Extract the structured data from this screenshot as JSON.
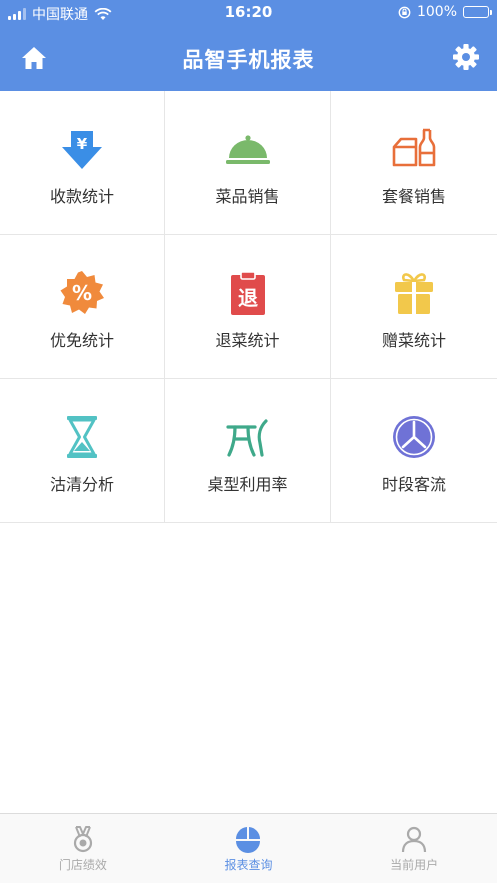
{
  "status_bar": {
    "carrier": "中国联通",
    "time": "16:20",
    "battery": "100%"
  },
  "nav": {
    "title": "品智手机报表",
    "home_icon": "home-icon",
    "settings_icon": "gear-icon"
  },
  "grid": {
    "items": [
      {
        "label": "收款统计",
        "icon": "yen-down-arrow-icon",
        "color": "#3a8ee6"
      },
      {
        "label": "菜品销售",
        "icon": "food-cloche-icon",
        "color": "#7ab96b"
      },
      {
        "label": "套餐销售",
        "icon": "meal-set-icon",
        "color": "#e86f3a"
      },
      {
        "label": "优免统计",
        "icon": "discount-badge-icon",
        "color": "#f08a3c"
      },
      {
        "label": "退菜统计",
        "icon": "return-clipboard-icon",
        "color": "#e04b4b"
      },
      {
        "label": "赠菜统计",
        "icon": "gift-icon",
        "color": "#f2c84b"
      },
      {
        "label": "沽清分析",
        "icon": "hourglass-icon",
        "color": "#52c2c4"
      },
      {
        "label": "桌型利用率",
        "icon": "table-icon",
        "color": "#3fa98a"
      },
      {
        "label": "时段客流",
        "icon": "clock-icon",
        "color": "#6f72d6"
      }
    ]
  },
  "tabbar": {
    "tabs": [
      {
        "label": "门店绩效",
        "icon": "medal-icon",
        "active": false
      },
      {
        "label": "报表查询",
        "icon": "pie-chart-icon",
        "active": true
      },
      {
        "label": "当前用户",
        "icon": "user-icon",
        "active": false
      }
    ],
    "active_color": "#5b8fe3",
    "inactive_color": "#aaaaaa"
  }
}
